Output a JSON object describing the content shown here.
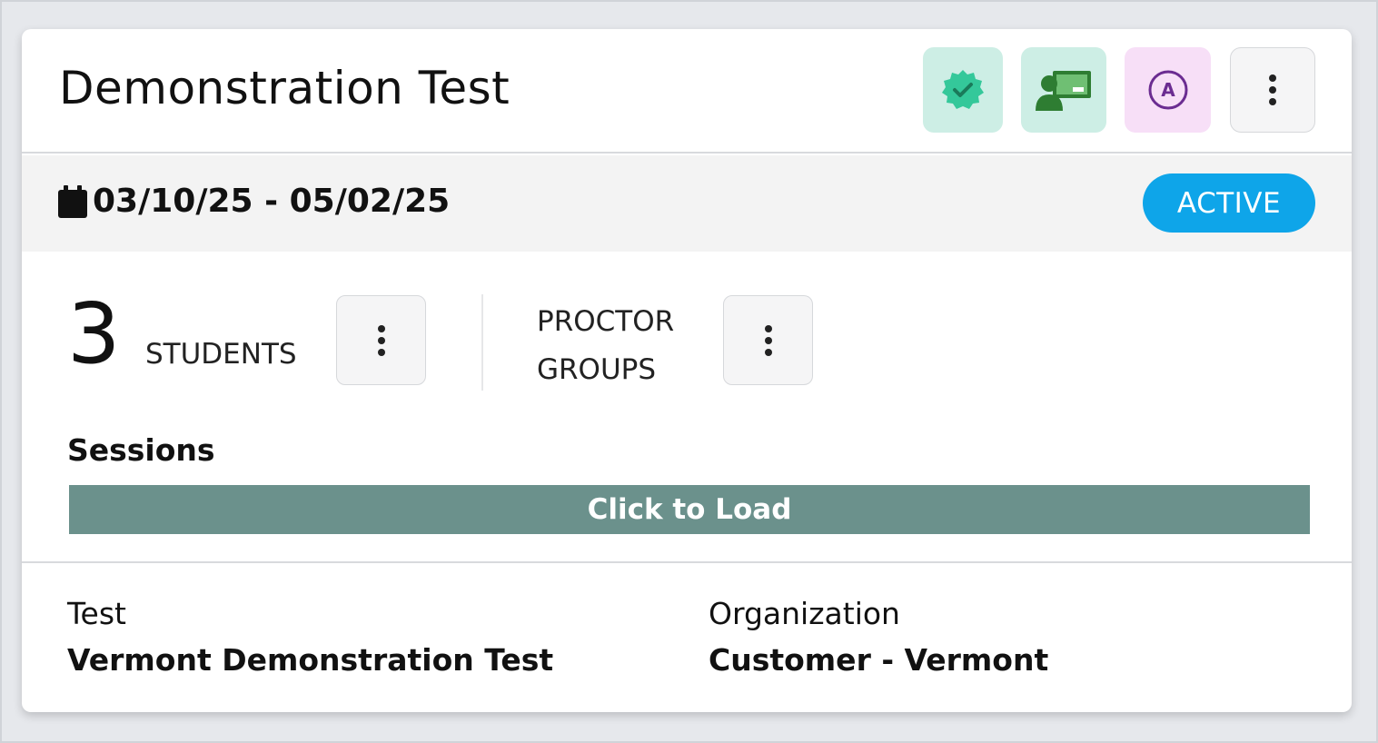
{
  "card": {
    "title": "Demonstration Test",
    "icons": {
      "verified": "verified-badge-icon",
      "proctor": "proctor-classroom-icon",
      "accommodation": "accommodation-a-icon",
      "more": "more-vertical-icon"
    },
    "colors": {
      "verified_bg": "#cdeee5",
      "verified_icon": "#34c89a",
      "proctor_icon": "#2e7d32",
      "accommodation_bg": "#f7dff7",
      "accommodation_icon": "#6b2c91",
      "status_active": "#0ea5e9",
      "load_bar": "#6b918c"
    }
  },
  "schedule": {
    "date_range": "03/10/25 - 05/02/25",
    "calendar_icon": "calendar-icon",
    "status": "ACTIVE"
  },
  "stats": {
    "students_count": "3",
    "students_label": "STUDENTS",
    "proctor_groups_label": "PROCTOR\nGROUPS"
  },
  "sessions": {
    "label": "Sessions",
    "load_button": "Click to Load"
  },
  "details": {
    "test_label": "Test",
    "test_value": "Vermont Demonstration Test",
    "org_label": "Organization",
    "org_value": "Customer - Vermont"
  }
}
